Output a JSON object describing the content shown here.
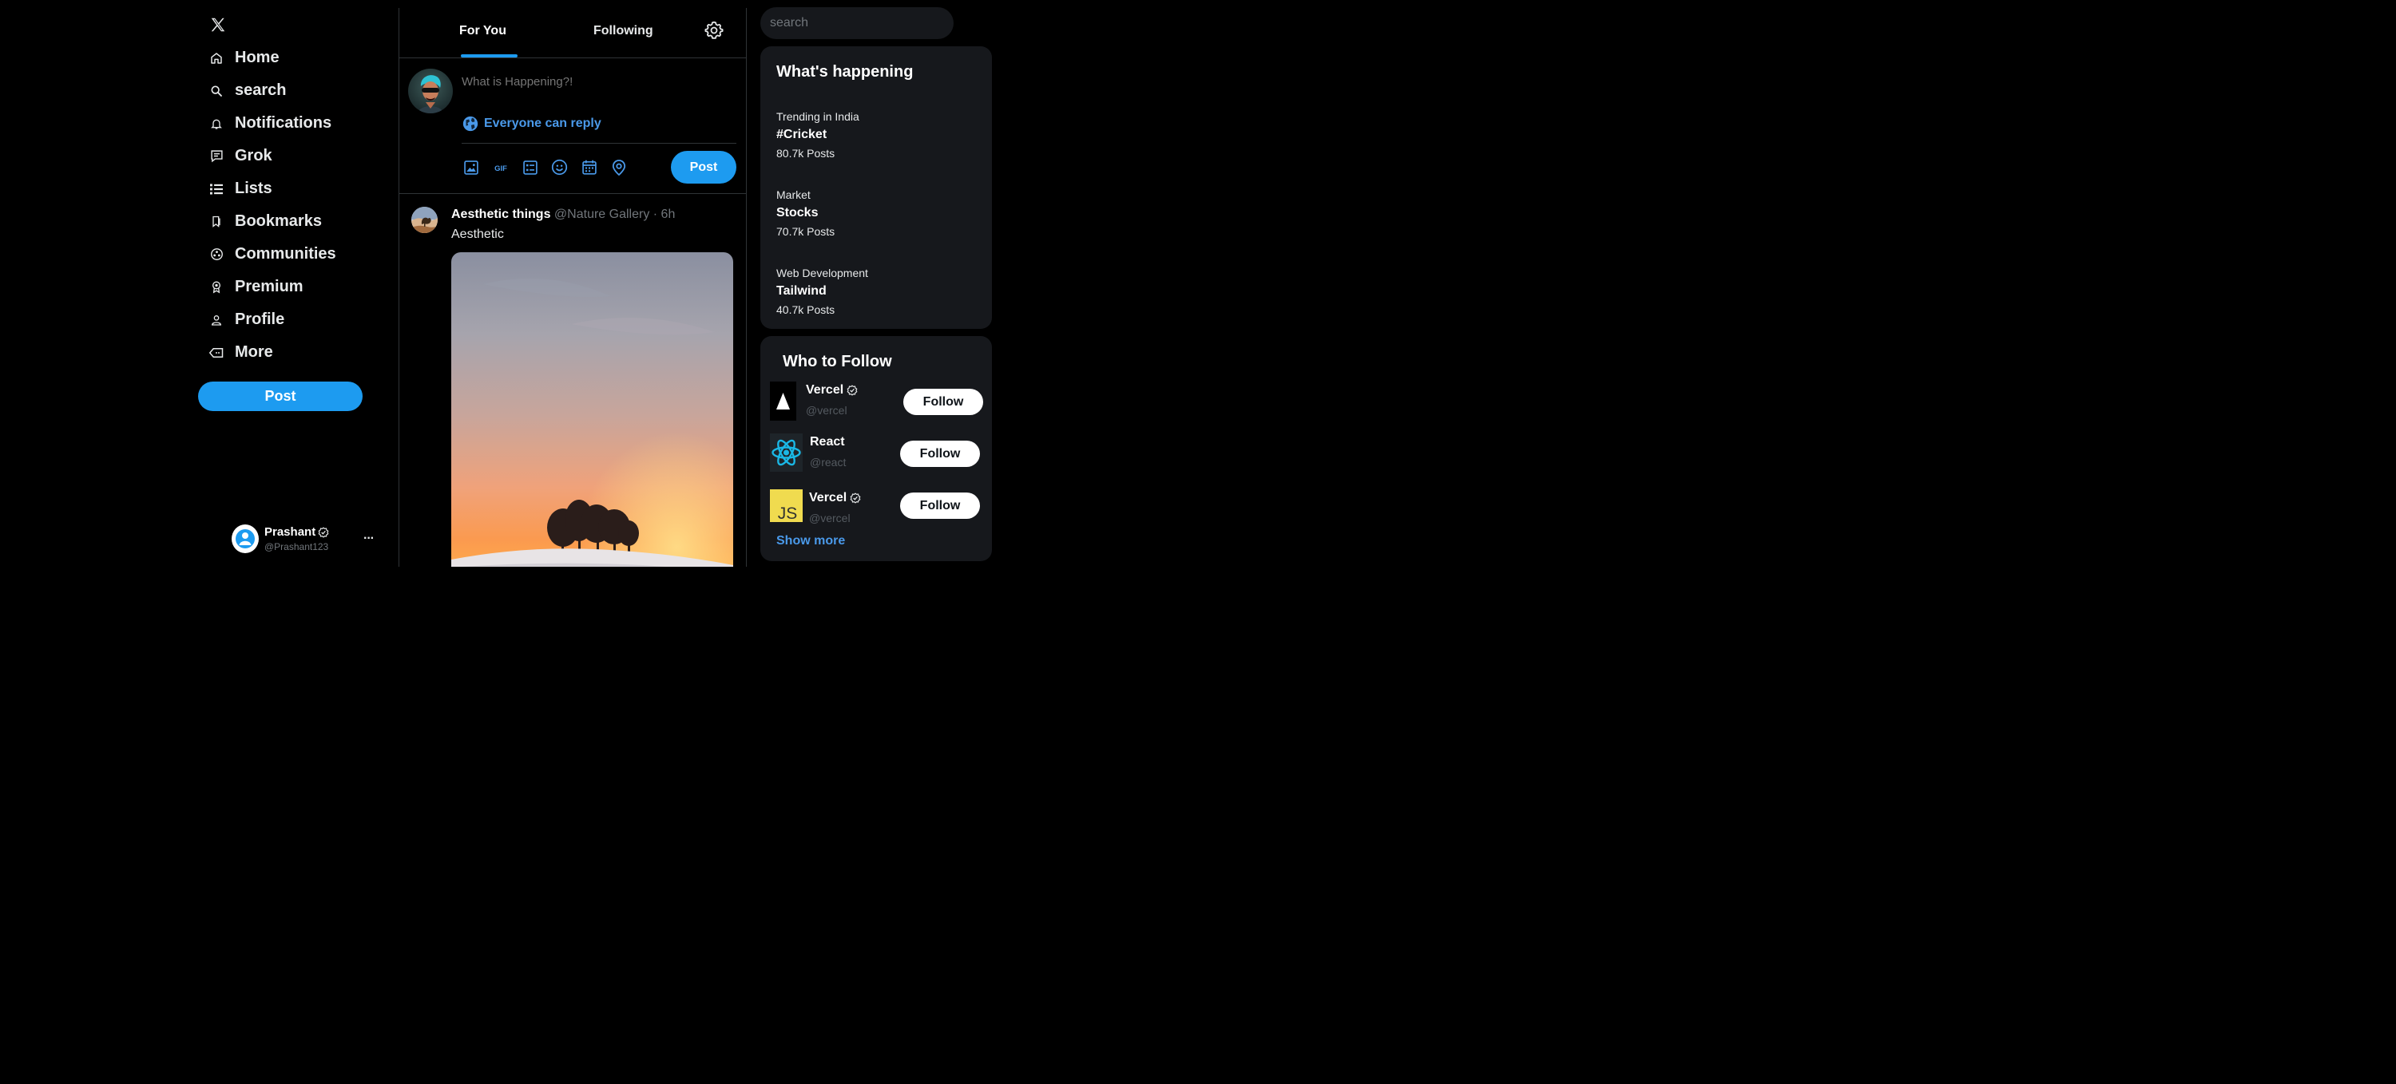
{
  "nav": {
    "logo": "x-logo-icon",
    "items": [
      {
        "label": "Home",
        "icon": "home-icon"
      },
      {
        "label": "search",
        "icon": "search-icon"
      },
      {
        "label": "Notifications",
        "icon": "bell-icon"
      },
      {
        "label": "Grok",
        "icon": "grok-icon"
      },
      {
        "label": "Lists",
        "icon": "list-icon"
      },
      {
        "label": "Bookmarks",
        "icon": "bookmark-icon"
      },
      {
        "label": "Communities",
        "icon": "communities-icon"
      },
      {
        "label": "Premium",
        "icon": "premium-icon"
      },
      {
        "label": "Profile",
        "icon": "profile-icon"
      },
      {
        "label": "More",
        "icon": "more-icon"
      }
    ],
    "post_label": "Post"
  },
  "account": {
    "name": "Prashant",
    "handle": "@Prashant123",
    "more": "···"
  },
  "feed": {
    "tabs": [
      {
        "label": "For You",
        "active": true
      },
      {
        "label": "Following",
        "active": false
      }
    ],
    "composer": {
      "placeholder": "What is Happening?!",
      "reply_label": "Everyone can reply",
      "tools": [
        "image-icon",
        "gif-icon",
        "poll-icon",
        "emoji-icon",
        "schedule-icon",
        "location-icon"
      ],
      "post_label": "Post"
    },
    "tweet": {
      "name": "Aesthetic things",
      "handle": "@Nature Gallery",
      "sep": "·",
      "time": "6h",
      "text": "Aesthetic"
    }
  },
  "sidebar": {
    "search_placeholder": "search",
    "happening": {
      "title": "What's happening",
      "trends": [
        {
          "category": "Trending in India",
          "topic": "#Cricket",
          "count": "80.7k Posts"
        },
        {
          "category": "Market",
          "topic": "Stocks",
          "count": "70.7k Posts"
        },
        {
          "category": "Web Development",
          "topic": "Tailwind",
          "count": "40.7k Posts"
        }
      ]
    },
    "who_to_follow": {
      "title": "Who to Follow",
      "suggestions": [
        {
          "name": "Vercel",
          "handle": "@vercel",
          "verified": true,
          "follow_label": "Follow"
        },
        {
          "name": "React",
          "handle": "@react",
          "verified": false,
          "follow_label": "Follow"
        },
        {
          "name": "Vercel",
          "handle": "@vercel",
          "verified": true,
          "follow_label": "Follow"
        }
      ],
      "show_more": "Show more"
    }
  },
  "colors": {
    "accent": "#1d9bf0",
    "link": "#4a99e9",
    "card": "#16181c",
    "border": "#2f3336"
  }
}
